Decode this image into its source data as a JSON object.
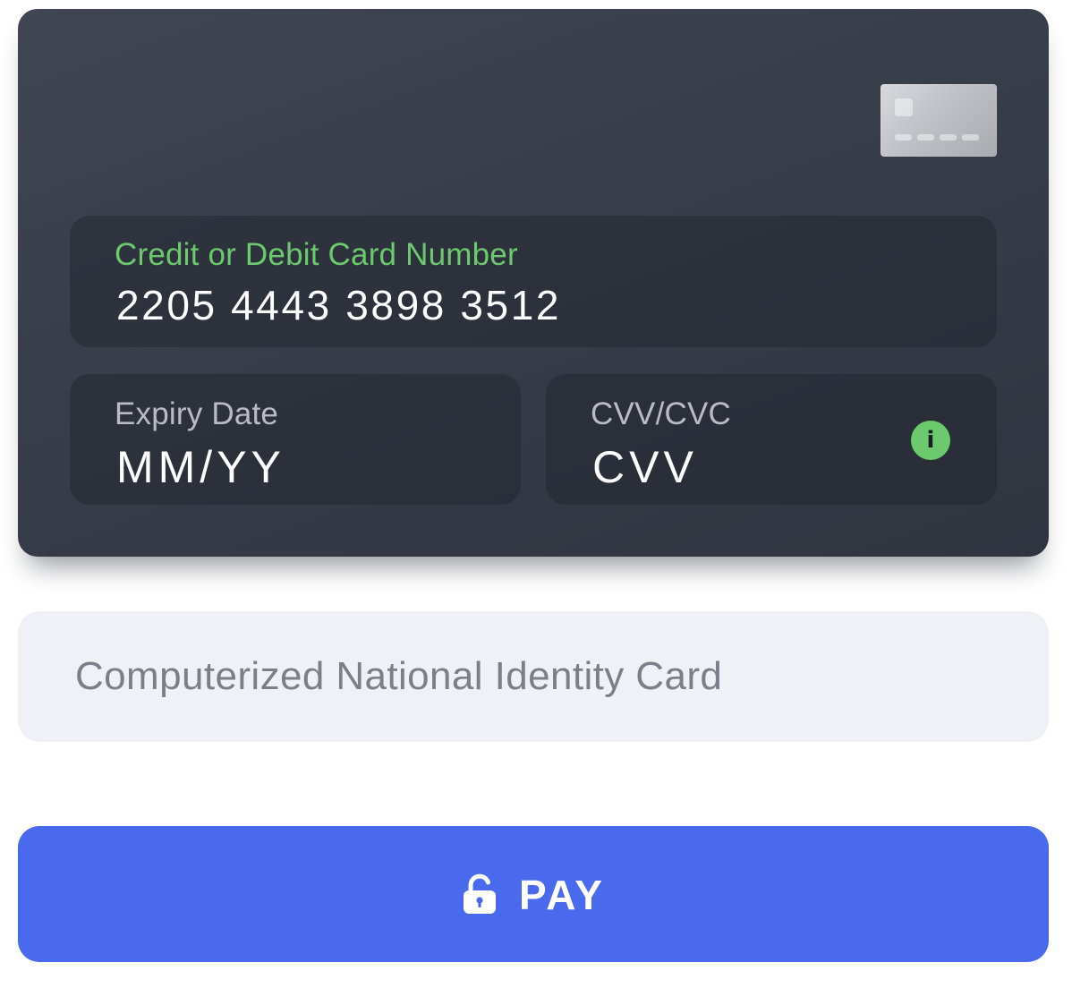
{
  "card": {
    "number_label": "Credit or Debit Card Number",
    "number_value": "2205 4443 3898 3512",
    "expiry_label": "Expiry Date",
    "expiry_placeholder": "MM/YY",
    "cvv_label": "CVV/CVC",
    "cvv_placeholder": "CVV",
    "info_icon_glyph": "i",
    "info_icon": "info-icon",
    "chip_icon": "card-chip-icon"
  },
  "cnic": {
    "placeholder": "Computerized National Identity Card"
  },
  "pay": {
    "label": "PAY",
    "icon": "lock-icon"
  },
  "colors": {
    "card_bg": "#3a3f4b",
    "accent_green": "#6cc96e",
    "button_blue": "#4a6aed",
    "input_bg": "#f0f1f6"
  }
}
